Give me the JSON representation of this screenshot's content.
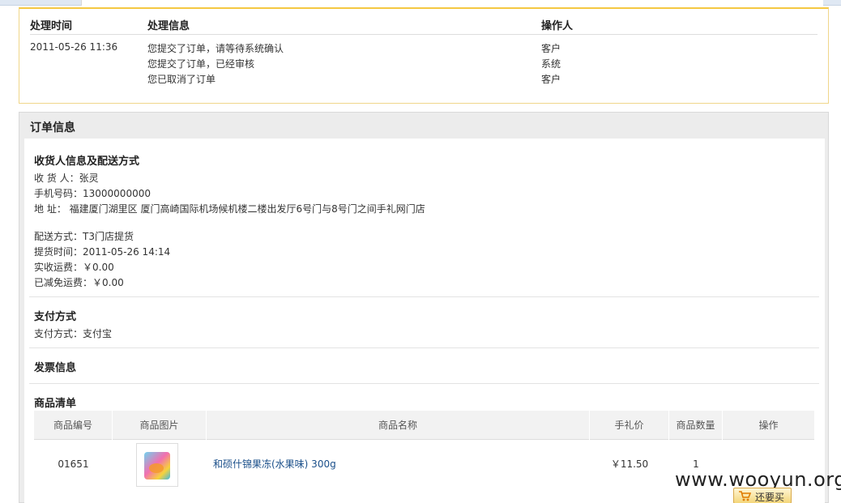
{
  "log": {
    "headers": {
      "time": "处理时间",
      "info": "处理信息",
      "operator": "操作人"
    },
    "time": "2011-05-26 11:36",
    "rows": [
      {
        "info": "您提交了订单，请等待系统确认",
        "operator": "客户"
      },
      {
        "info": "您提交了订单，已经审核",
        "operator": "系统"
      },
      {
        "info": "您已取消了订单",
        "operator": "客户"
      }
    ]
  },
  "order": {
    "title": "订单信息",
    "consignee": {
      "title": "收货人信息及配送方式",
      "name": "收 货 人：张灵",
      "phone": "手机号码：13000000000",
      "address": "地 址：  福建厦门湖里区 厦门高崎国际机场候机楼二楼出发厅6号门与8号门之间手礼网门店",
      "delivery": "配送方式：T3门店提货",
      "pickup_time": "提货时间：2011-05-26 14:14",
      "shipping_fee": "实收运费：￥0.00",
      "discount_fee": "已减免运费：￥0.00"
    },
    "payment": {
      "title": "支付方式",
      "method": "支付方式：支付宝"
    },
    "invoice": {
      "title": "发票信息"
    },
    "goods": {
      "title": "商品清单",
      "headers": {
        "code": "商品编号",
        "image": "商品图片",
        "name": "商品名称",
        "price": "手礼价",
        "qty": "商品数量",
        "action": "操作"
      },
      "items": [
        {
          "code": "01651",
          "name": "和硕什锦果冻(水果味) 300g",
          "price": "￥11.50",
          "qty": "1"
        }
      ]
    }
  },
  "buy_button": {
    "label": "还要买"
  },
  "watermark": "www.wooyun.org"
}
